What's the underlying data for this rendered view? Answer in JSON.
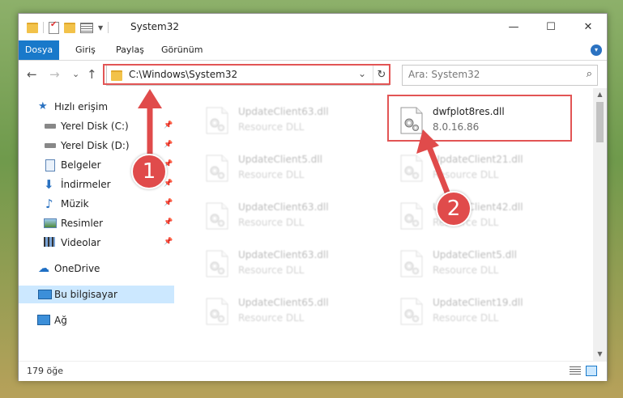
{
  "window": {
    "title": "System32",
    "controls": {
      "minimize": "—",
      "maximize": "☐",
      "close": "✕"
    }
  },
  "ribbon": {
    "tabs": [
      {
        "label": "Dosya"
      },
      {
        "label": "Giriş"
      },
      {
        "label": "Paylaş"
      },
      {
        "label": "Görünüm"
      }
    ],
    "expand": "▾"
  },
  "nav": {
    "back": "←",
    "forward": "→",
    "recent": "⌄",
    "up": "↑",
    "address": "C:\\Windows\\System32",
    "address_dropdown": "⌄",
    "refresh": "↻",
    "search_placeholder": "Ara: System32",
    "search_icon": "⌕"
  },
  "sidebar": {
    "items": [
      {
        "label": "Hızlı erişim",
        "icon": "star-icon"
      },
      {
        "label": "Yerel Disk (C:)",
        "icon": "drive-icon",
        "pinned": true
      },
      {
        "label": "Yerel Disk (D:)",
        "icon": "drive-icon",
        "pinned": true
      },
      {
        "label": "Belgeler",
        "icon": "document-icon",
        "pinned": true
      },
      {
        "label": "İndirmeler",
        "icon": "download-icon",
        "pinned": true
      },
      {
        "label": "Müzik",
        "icon": "music-icon",
        "pinned": true
      },
      {
        "label": "Resimler",
        "icon": "pictures-icon",
        "pinned": true
      },
      {
        "label": "Videolar",
        "icon": "video-icon",
        "pinned": true
      },
      {
        "label": "OneDrive",
        "icon": "cloud-icon"
      },
      {
        "label": "Bu bilgisayar",
        "icon": "computer-icon",
        "selected": true
      },
      {
        "label": "Ağ",
        "icon": "network-icon"
      }
    ],
    "pin_glyph": "📌"
  },
  "files": [
    {
      "name": "UpdateClient63.dll",
      "type": "Resource DLL",
      "faded": true
    },
    {
      "name": "dwfplot8res.dll",
      "type": "8.0.16.86",
      "faded": false
    },
    {
      "name": "UpdateClient5.dll",
      "type": "Resource DLL",
      "faded": true
    },
    {
      "name": "UpdateClient21.dll",
      "type": "Resource DLL",
      "faded": true
    },
    {
      "name": "UpdateClient63.dll",
      "type": "Resource DLL",
      "faded": true
    },
    {
      "name": "UpdateClient42.dll",
      "type": "Resource DLL",
      "faded": true
    },
    {
      "name": "UpdateClient63.dll",
      "type": "Resource DLL",
      "faded": true
    },
    {
      "name": "UpdateClient5.dll",
      "type": "Resource DLL",
      "faded": true
    },
    {
      "name": "UpdateClient65.dll",
      "type": "Resource DLL",
      "faded": true
    },
    {
      "name": "UpdateClient19.dll",
      "type": "Resource DLL",
      "faded": true
    }
  ],
  "status": {
    "count": "179 öğe"
  },
  "annotations": {
    "step1": "1",
    "step2": "2",
    "color": "#e04b4b"
  }
}
